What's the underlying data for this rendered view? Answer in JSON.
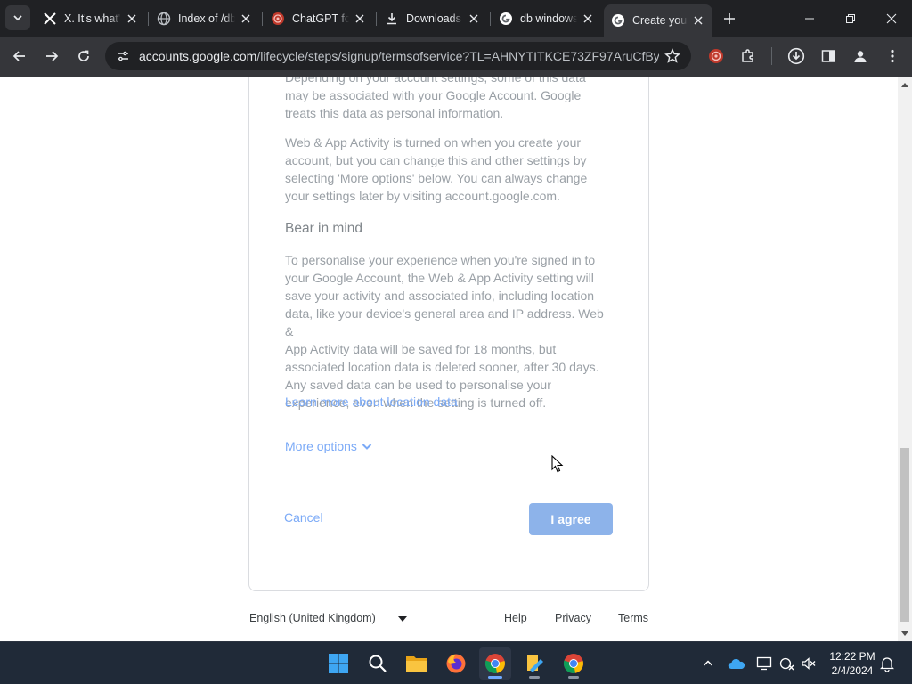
{
  "browser": {
    "tabs": [
      {
        "label": "X. It's what's happening",
        "icon": "x-logo-icon"
      },
      {
        "label": "Index of /db",
        "icon": "globe-icon"
      },
      {
        "label": "ChatGPT for Google",
        "icon": "chatgpt-icon"
      },
      {
        "label": "Downloads",
        "icon": "download-icon"
      },
      {
        "label": "db windows",
        "icon": "google-icon"
      },
      {
        "label": "Create your Google Account",
        "icon": "google-icon",
        "active": true
      }
    ],
    "url_host": "accounts.google.com",
    "url_path": "/lifecycle/steps/signup/termsofservice?TL=AHNYTITKCE73ZF97AruCfBy..."
  },
  "page": {
    "para_top": "Depending on your account settings, some of this data may be associated with your Google Account. Google treats this data as personal information.",
    "para_top_line1": "Depending on your account settings, some of this data",
    "para_top_line2": "may be associated with your Google Account. Google",
    "para_top_line3": "treats this data as personal information.",
    "para_activity_line1": "Web & App Activity is turned on when you create your",
    "para_activity_line2": "account, but you can change this and other settings by",
    "para_activity_line3": "selecting 'More options' below. You can always change",
    "para_activity_line4": "your settings later by visiting account.google.com.",
    "heading": "Bear in mind",
    "para_bear_lines": [
      "To personalise your experience when you're signed in to",
      "your Google Account, the Web & App Activity setting will",
      "save your activity and associated info, including location",
      "data, like your device's general area and IP address. Web &",
      "App Activity data will be saved for 18 months, but",
      "associated location data is deleted sooner, after 30 days.",
      "Any saved data can be used to personalise your",
      "experience, even when the setting is turned off."
    ],
    "learn_more": "Learn more about location data",
    "more_options": "More options",
    "cancel": "Cancel",
    "agree": "I agree"
  },
  "footer": {
    "language": "English (United Kingdom)",
    "help": "Help",
    "privacy": "Privacy",
    "terms": "Terms"
  },
  "taskbar": {
    "time": "12:22 PM",
    "date": "2/4/2024"
  },
  "colors": {
    "link": "#7baaf7",
    "agree_button": "#8db3ea",
    "text_muted": "#9aa0a6"
  }
}
